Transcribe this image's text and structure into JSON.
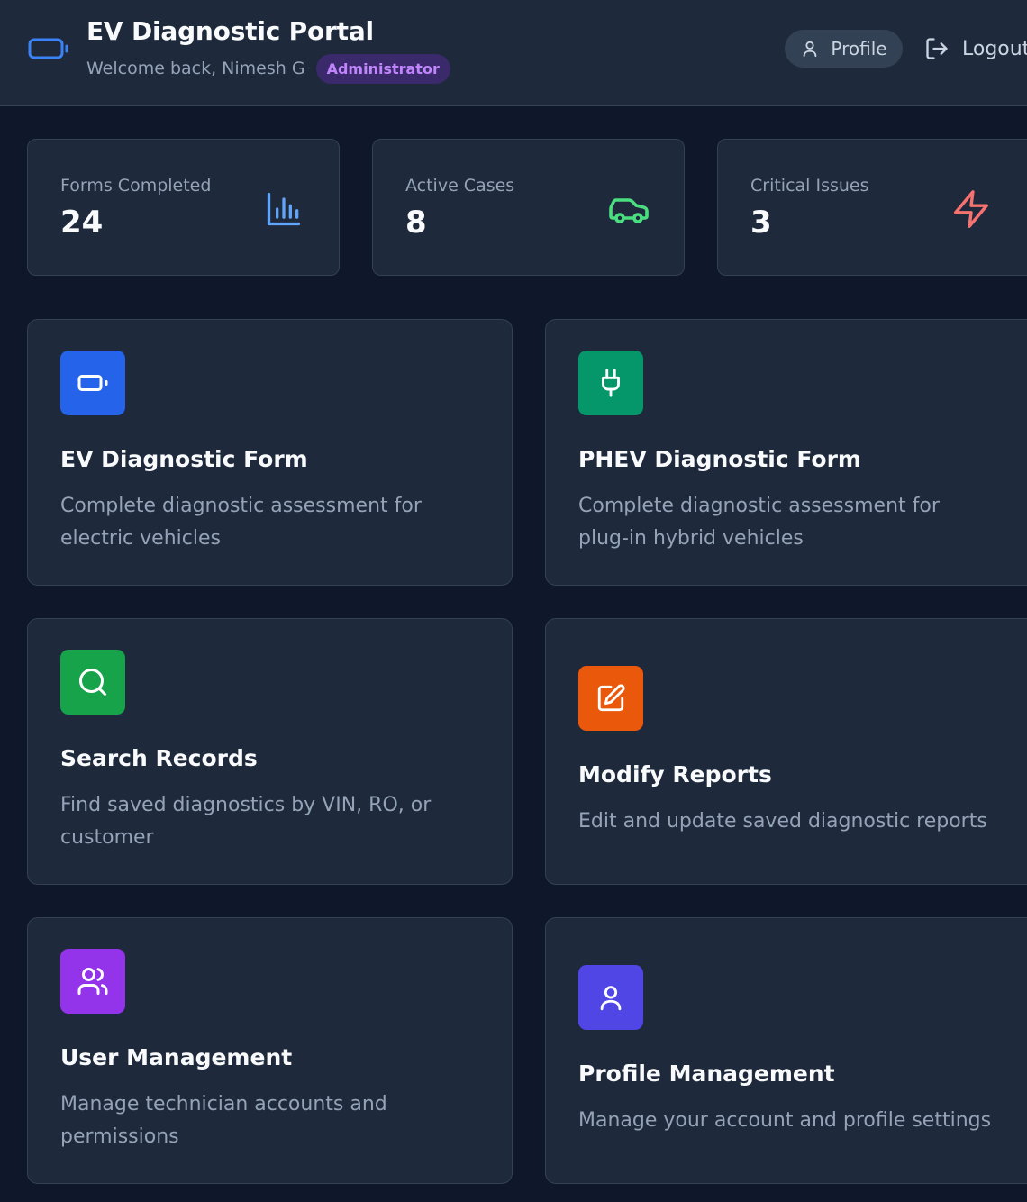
{
  "header": {
    "title": "EV Diagnostic Portal",
    "welcome": "Welcome back, Nimesh G",
    "role_badge": "Administrator",
    "brand_icon": "battery-icon",
    "profile_label": "Profile",
    "logout_label": "Logout"
  },
  "stats": [
    {
      "label": "Forms Completed",
      "value": "24",
      "icon": "bar-chart-icon",
      "color": "#60a5fa"
    },
    {
      "label": "Active Cases",
      "value": "8",
      "icon": "car-icon",
      "color": "#4ade80"
    },
    {
      "label": "Critical Issues",
      "value": "3",
      "icon": "lightning-icon",
      "color": "#f87171"
    }
  ],
  "cards": [
    {
      "title": "EV Diagnostic Form",
      "description": "Complete diagnostic assessment for electric vehicles",
      "icon": "battery-icon",
      "color": "#2563eb"
    },
    {
      "title": "PHEV Diagnostic Form",
      "description": "Complete diagnostic assessment for plug-in hybrid vehicles",
      "icon": "plug-icon",
      "color": "#059669"
    },
    {
      "title": "Search Records",
      "description": "Find saved diagnostics by VIN, RO, or customer",
      "icon": "search-icon",
      "color": "#16a34a"
    },
    {
      "title": "Modify Reports",
      "description": "Edit and update saved diagnostic reports",
      "icon": "edit-icon",
      "color": "#ea580c"
    },
    {
      "title": "User Management",
      "description": "Manage technician accounts and permissions",
      "icon": "users-icon",
      "color": "#9333ea"
    },
    {
      "title": "Profile Management",
      "description": "Manage your account and profile settings",
      "icon": "user-icon",
      "color": "#4f46e5"
    }
  ]
}
